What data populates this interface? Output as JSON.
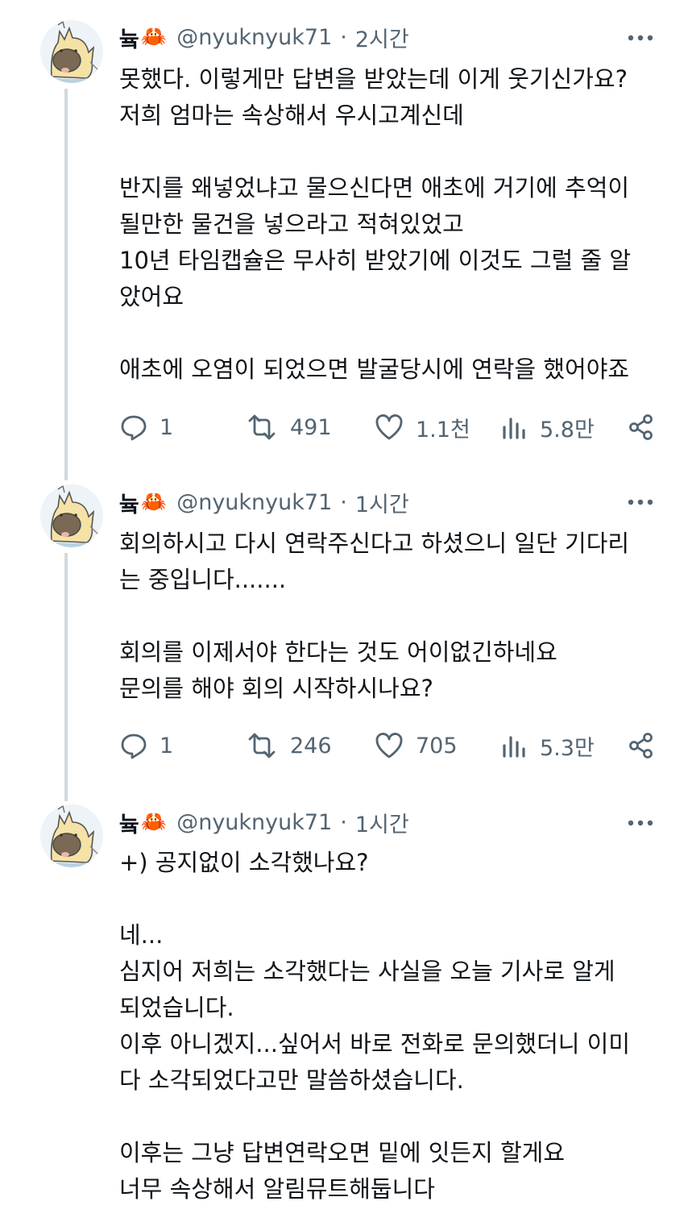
{
  "tweets": [
    {
      "author": {
        "name": "늌",
        "emoji": "🦀",
        "handle": "@nyuknyuk71",
        "separator": "·"
      },
      "time": "2시간",
      "text": "못했다. 이렇게만 답변을 받았는데 이게 웃기신가요?\n저희 엄마는 속상해서 우시고계신데\n\n반지를 왜넣었냐고 물으신다면 애초에 거기에 추억이\n될만한 물건을 넣으라고 적혀있었고\n10년 타임캡슐은 무사히 받았기에 이것도 그럴 줄 알\n았어요\n\n애초에 오염이 되었으면 발굴당시에 연락을 했어야죠",
      "stats": {
        "replies": "1",
        "retweets": "491",
        "likes": "1.1천",
        "views": "5.8만"
      }
    },
    {
      "author": {
        "name": "늌",
        "emoji": "🦀",
        "handle": "@nyuknyuk71",
        "separator": "·"
      },
      "time": "1시간",
      "text": "회의하시고 다시 연락주신다고 하셨으니 일단 기다리\n는 중입니다.......\n\n회의를 이제서야 한다는 것도 어이없긴하네요\n문의를 해야 회의 시작하시나요?",
      "stats": {
        "replies": "1",
        "retweets": "246",
        "likes": "705",
        "views": "5.3만"
      }
    },
    {
      "author": {
        "name": "늌",
        "emoji": "🦀",
        "handle": "@nyuknyuk71",
        "separator": "·"
      },
      "time": "1시간",
      "text": "+) 공지없이 소각했나요?\n\n네...\n심지어 저희는 소각했다는 사실을 오늘 기사로 알게\n되었습니다.\n이후 아니겠지...싶어서 바로 전화로 문의했더니 이미\n다 소각되었다고만 말씀하셨습니다.\n\n이후는 그냥 답변연락오면 밑에 잇든지 할게요\n너무 속상해서 알림뮤트해둡니다"
    }
  ],
  "icons": [
    "more-icon",
    "reply-icon",
    "retweet-icon",
    "like-icon",
    "views-icon",
    "share-icon"
  ],
  "colors": {
    "text": "#0f1419",
    "secondary": "#536471",
    "thread_line": "#cfd9de"
  }
}
